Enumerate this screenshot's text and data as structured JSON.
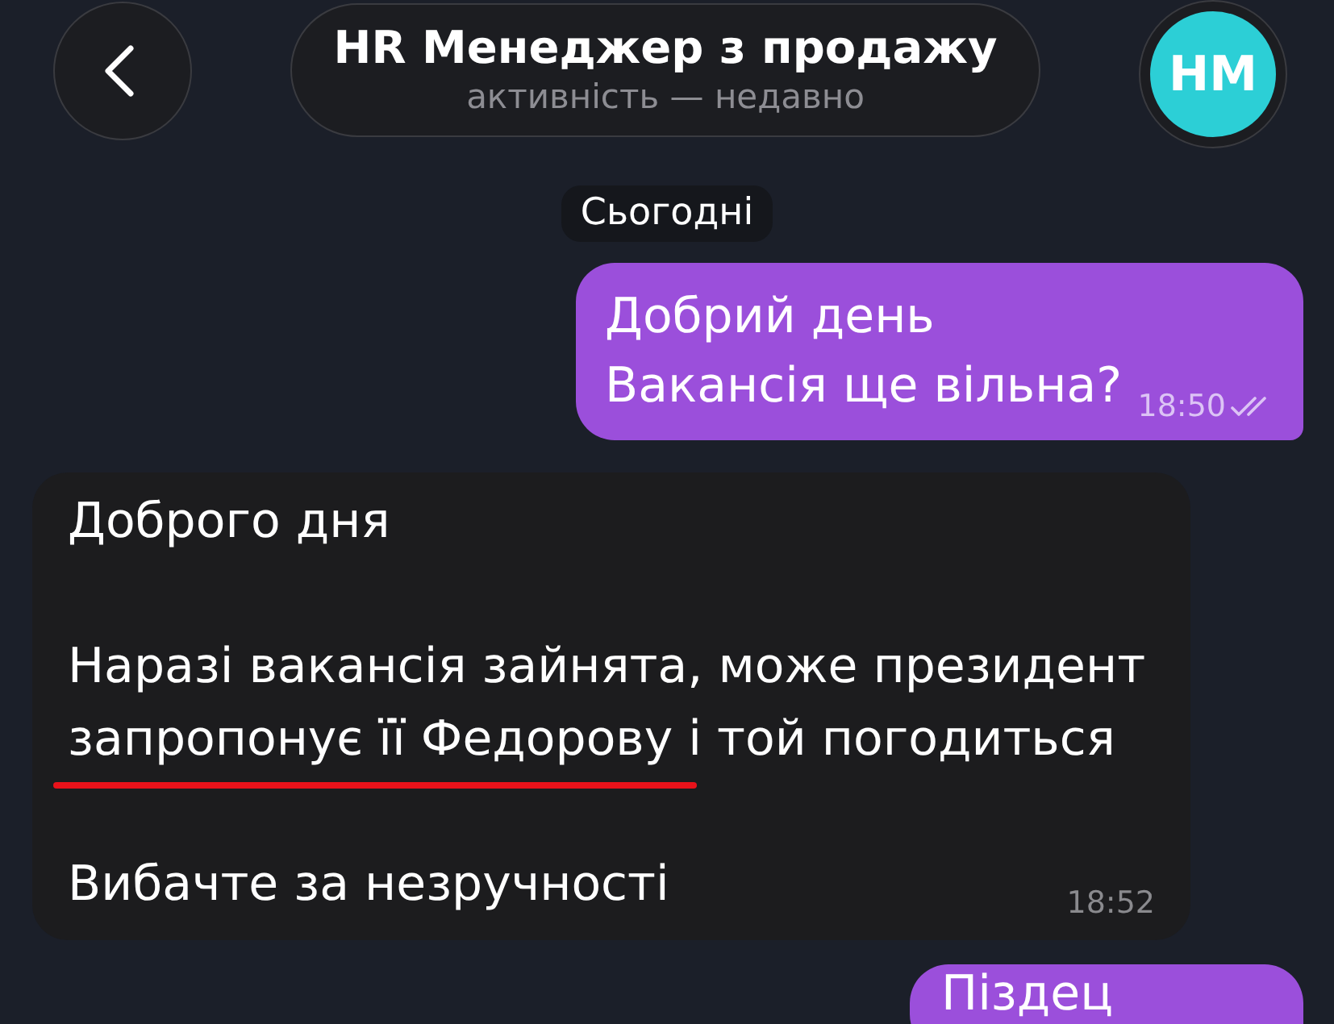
{
  "header": {
    "title": "HR Менеджер з продажу",
    "status": "активність — недавно",
    "avatar_initials": "HМ"
  },
  "date_separator": "Сьогодні",
  "messages": [
    {
      "kind": "outgoing",
      "text": "Добрий день\nВакансія ще вільна?",
      "time": "18:50",
      "read": true
    },
    {
      "kind": "incoming",
      "paragraphs": [
        "Доброго дня",
        "Наразі вакансія зайнята, може президент запропонує її Федорову і той погодиться",
        "Вибачте за незручності"
      ],
      "time": "18:52",
      "annotation": {
        "kind": "underline"
      }
    },
    {
      "kind": "outgoing",
      "text": "Піздец"
    }
  ]
}
